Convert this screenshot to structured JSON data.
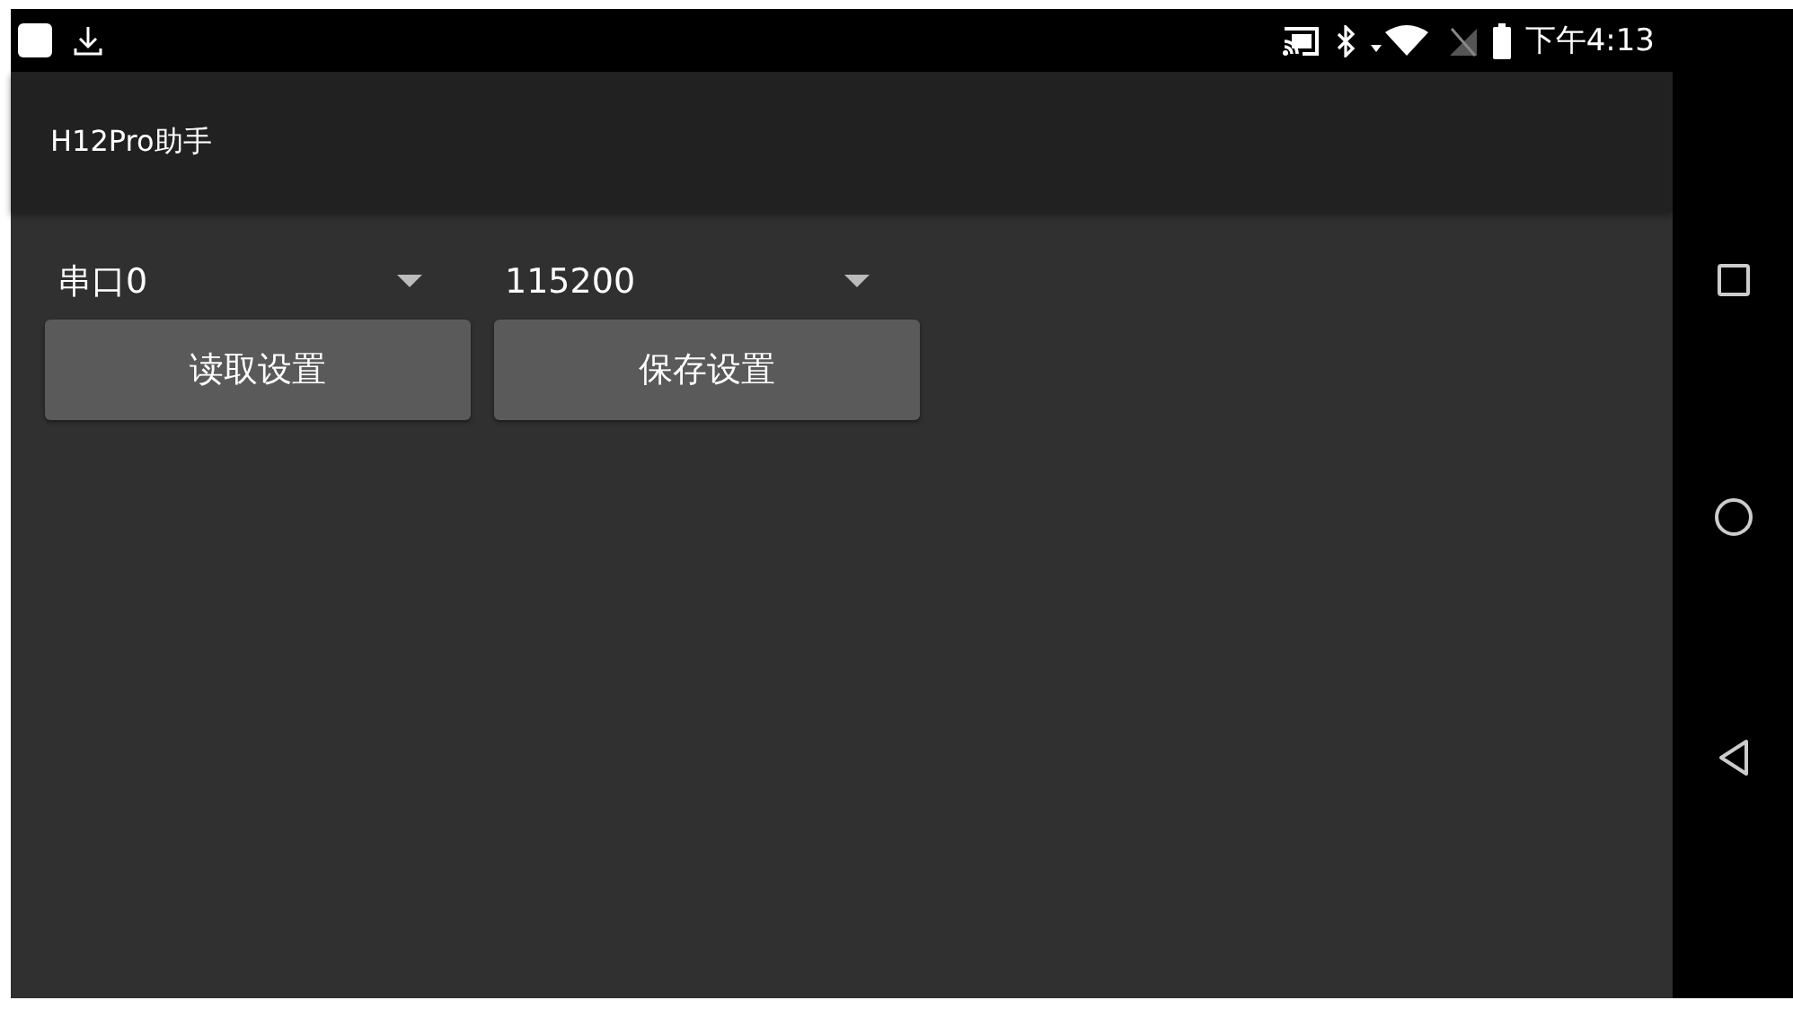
{
  "status_bar": {
    "time": "下午4:13"
  },
  "app_bar": {
    "title": "H12Pro助手"
  },
  "spinners": [
    {
      "value": "串口0"
    },
    {
      "value": "115200"
    }
  ],
  "buttons": [
    "读取设置",
    "保存设置"
  ]
}
